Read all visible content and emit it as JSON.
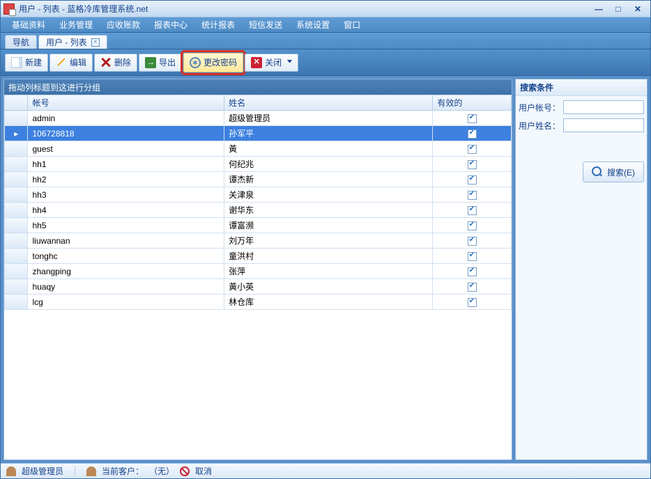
{
  "window": {
    "title": "用户 - 列表 - 蓝格冷库管理系统.net"
  },
  "menu": [
    "基础资料",
    "业务管理",
    "应收账款",
    "报表中心",
    "统计报表",
    "短信发送",
    "系统设置",
    "窗口"
  ],
  "tabs": [
    {
      "label": "导航",
      "active": false,
      "closable": false
    },
    {
      "label": "用户 - 列表",
      "active": true,
      "closable": true
    }
  ],
  "toolbar": {
    "new": "新建",
    "edit": "编辑",
    "delete": "删除",
    "export": "导出",
    "changepwd": "更改密码",
    "close": "关闭"
  },
  "group_hint": "拖动列标题到这进行分组",
  "columns": {
    "account": "帐号",
    "name": "姓名",
    "valid": "有效的"
  },
  "rows": [
    {
      "acct": "admin",
      "name": "超级管理员",
      "valid": true,
      "selected": false
    },
    {
      "acct": "106728818",
      "name": "孙军平",
      "valid": true,
      "selected": true
    },
    {
      "acct": "guest",
      "name": "黃",
      "valid": true,
      "selected": false
    },
    {
      "acct": "hh1",
      "name": "何纪兆",
      "valid": true,
      "selected": false
    },
    {
      "acct": "hh2",
      "name": "谭杰新",
      "valid": true,
      "selected": false
    },
    {
      "acct": "hh3",
      "name": "关津泉",
      "valid": true,
      "selected": false
    },
    {
      "acct": "hh4",
      "name": "谢华东",
      "valid": true,
      "selected": false
    },
    {
      "acct": "hh5",
      "name": "谭富濒",
      "valid": true,
      "selected": false
    },
    {
      "acct": "liuwannan",
      "name": "刘万年",
      "valid": true,
      "selected": false
    },
    {
      "acct": "tonghc",
      "name": "童洪村",
      "valid": true,
      "selected": false
    },
    {
      "acct": "zhangping",
      "name": "张萍",
      "valid": true,
      "selected": false
    },
    {
      "acct": "huaqy",
      "name": "黃小英",
      "valid": true,
      "selected": false
    },
    {
      "acct": "lcg",
      "name": "林仓库",
      "valid": true,
      "selected": false
    }
  ],
  "search": {
    "header": "搜索条件",
    "acct_label": "用户帐号：",
    "name_label": "用户姓名：",
    "acct_value": "",
    "name_value": "",
    "button": "搜索(E)"
  },
  "status": {
    "user": "超级管理员",
    "current_label": "当前客户：",
    "current_value": "（无）",
    "cancel": "取消"
  }
}
